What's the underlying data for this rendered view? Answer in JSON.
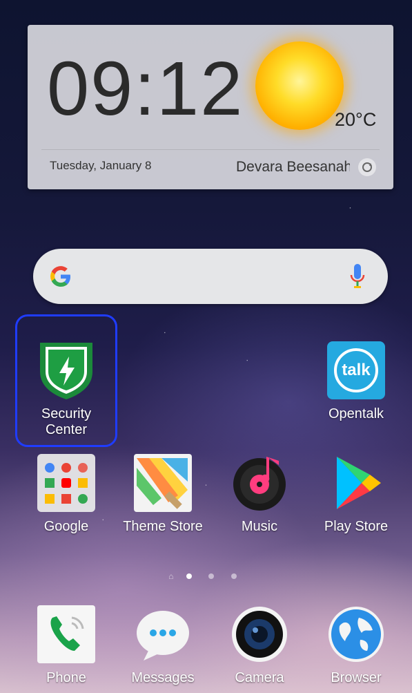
{
  "widget": {
    "time": "09:12",
    "temperature": "20°C",
    "date": "Tuesday, January 8",
    "location": "Devara Beesanahalli"
  },
  "search": {
    "logo": "G",
    "mic_icon": "mic-icon"
  },
  "apps": {
    "security_center": {
      "label_line1": "Security",
      "label_line2": "Center"
    },
    "opentalk": {
      "label": "Opentalk",
      "icon_text": "talk"
    },
    "google": {
      "label": "Google"
    },
    "theme_store": {
      "label": "Theme Store"
    },
    "music": {
      "label": "Music"
    },
    "play_store": {
      "label": "Play Store"
    }
  },
  "dock": {
    "phone": {
      "label": "Phone"
    },
    "messages": {
      "label": "Messages"
    },
    "camera": {
      "label": "Camera"
    },
    "browser": {
      "label": "Browser"
    }
  },
  "colors": {
    "highlight": "#1f3cff",
    "accent_green": "#1b8a3a",
    "opentalk_blue": "#25a9e0"
  }
}
